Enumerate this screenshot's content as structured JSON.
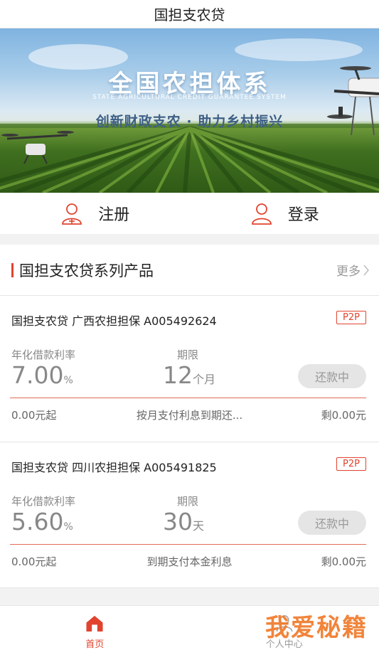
{
  "header": {
    "title": "国担支农贷"
  },
  "banner": {
    "headline": "全国农担体系",
    "subtitle_en": "STATE AGRICULTURAL CREDIT GUARANTEE SYSTEM",
    "slogan": "创新财政支农 · 助力乡村振兴"
  },
  "auth": {
    "register_label": "注册",
    "login_label": "登录"
  },
  "products": {
    "title": "国担支农贷系列产品",
    "more_label": "更多",
    "rate_label": "年化借款利率",
    "term_label": "期限",
    "items": [
      {
        "name": "国担支农贷 广西农担担保 A005492624",
        "tag": "P2P",
        "rate": "7.00",
        "rate_unit": "%",
        "term": "12",
        "term_unit": "个月",
        "status": "还款中",
        "min": "0.00元起",
        "method": "按月支付利息到期还...",
        "remain": "剩0.00元"
      },
      {
        "name": "国担支农贷 四川农担担保 A005491825",
        "tag": "P2P",
        "rate": "5.60",
        "rate_unit": "%",
        "term": "30",
        "term_unit": "天",
        "status": "还款中",
        "min": "0.00元起",
        "method": "到期支付本金利息",
        "remain": "剩0.00元"
      }
    ]
  },
  "tabbar": {
    "home_label": "首页",
    "profile_label": "个人中心"
  },
  "watermark": "我爱秘籍",
  "colors": {
    "accent": "#e0442e",
    "muted": "#888888",
    "divider": "#e46a56"
  }
}
